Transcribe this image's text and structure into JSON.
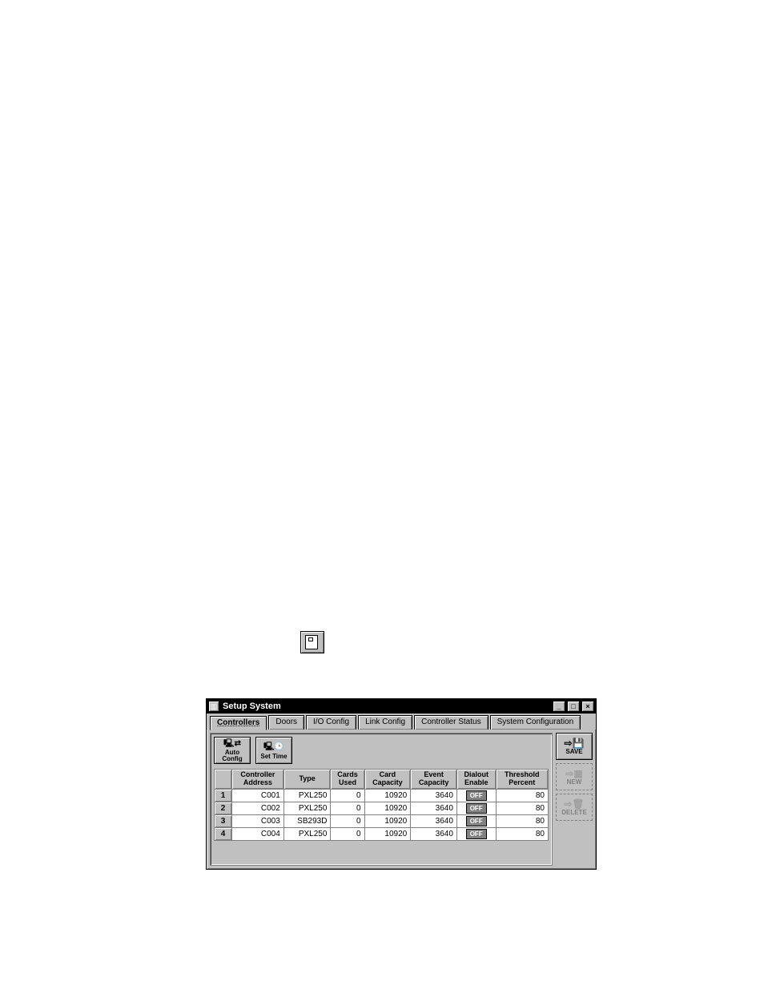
{
  "standalone_icon": {
    "name": "toolbar-setup-icon"
  },
  "window": {
    "title": "Setup System",
    "title_controls": {
      "minimize": "_",
      "maximize": "□",
      "close": "×"
    },
    "tabs": [
      {
        "label": "Controllers",
        "active": true
      },
      {
        "label": "Doors"
      },
      {
        "label": "I/O Config"
      },
      {
        "label": "Link Config"
      },
      {
        "label": "Controller Status"
      },
      {
        "label": "System Configuration"
      }
    ],
    "toolbar": {
      "auto_config": "Auto\nConfig",
      "set_time": "Set Time"
    },
    "side": {
      "save": "SAVE",
      "new": "NEW",
      "delete": "DELETE"
    },
    "table": {
      "headers": [
        "",
        "Controller\nAddress",
        "Type",
        "Cards\nUsed",
        "Card\nCapacity",
        "Event\nCapacity",
        "Dialout\nEnable",
        "Threshold\nPercent"
      ],
      "rows": [
        {
          "idx": "1",
          "addr": "C001",
          "type": "PXL250",
          "cards_used": "0",
          "card_cap": "10920",
          "evt_cap": "3640",
          "dialout": "OFF",
          "thresh": "80"
        },
        {
          "idx": "2",
          "addr": "C002",
          "type": "PXL250",
          "cards_used": "0",
          "card_cap": "10920",
          "evt_cap": "3640",
          "dialout": "OFF",
          "thresh": "80"
        },
        {
          "idx": "3",
          "addr": "C003",
          "type": "SB293D",
          "cards_used": "0",
          "card_cap": "10920",
          "evt_cap": "3640",
          "dialout": "OFF",
          "thresh": "80"
        },
        {
          "idx": "4",
          "addr": "C004",
          "type": "PXL250",
          "cards_used": "0",
          "card_cap": "10920",
          "evt_cap": "3640",
          "dialout": "OFF",
          "thresh": "80"
        }
      ]
    }
  }
}
